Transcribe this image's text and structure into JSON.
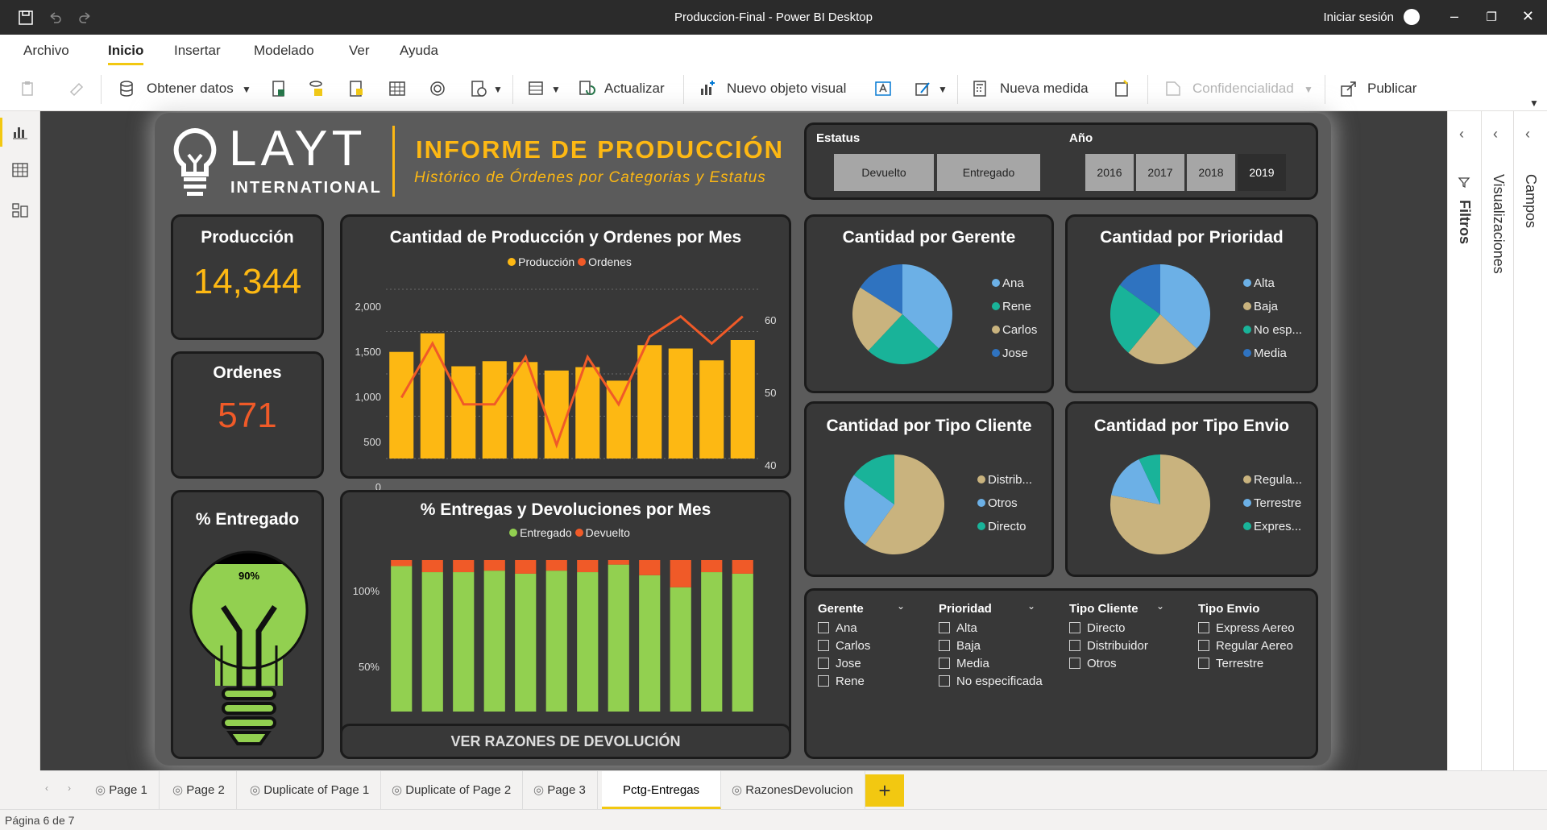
{
  "window": {
    "title": "Produccion-Final - Power BI Desktop",
    "signin": "Iniciar sesión"
  },
  "ribbon_tabs": [
    "Archivo",
    "Inicio",
    "Insertar",
    "Modelado",
    "Ver",
    "Ayuda"
  ],
  "toolbar": {
    "obtener": "Obtener datos",
    "actualizar": "Actualizar",
    "nuevo_visual": "Nuevo objeto visual",
    "nueva_medida": "Nueva medida",
    "confidencialidad": "Confidencialidad",
    "publicar": "Publicar"
  },
  "report": {
    "brand_main": "LAYT",
    "brand_sub": "INTERNATIONAL",
    "header_title": "INFORME DE PRODUCCIÓN",
    "header_subtitle": "Histórico de Órdenes por Categorias y Estatus",
    "estatus_label": "Estatus",
    "estatus_options": [
      "Devuelto",
      "Entregado"
    ],
    "anio_label": "Año",
    "anio_options": [
      "2016",
      "2017",
      "2018",
      "2019"
    ],
    "kpi_produccion": {
      "label": "Producción",
      "value": "14,344"
    },
    "kpi_ordenes": {
      "label": "Ordenes",
      "value": "571"
    },
    "kpi_entregado": {
      "label": "% Entregado",
      "value": "90%"
    },
    "button_razones": "VER RAZONES DE DEVOLUCIÓN"
  },
  "chart_data": [
    {
      "type": "bar",
      "title": "Cantidad de Producción y Ordenes por Mes",
      "series": [
        {
          "name": "Producción",
          "color": "#fdb813",
          "values": [
            1260,
            1480,
            1090,
            1150,
            1140,
            1040,
            1080,
            920,
            1340,
            1300,
            1160,
            1400
          ]
        },
        {
          "name": "Ordenes",
          "color": "#f05a28",
          "values": [
            44,
            52,
            43,
            43,
            50,
            37,
            50,
            43,
            53,
            56,
            52,
            56
          ]
        }
      ],
      "y_left_ticks": [
        "2,000",
        "1,500",
        "1,000",
        "500",
        "0"
      ],
      "y_right_ticks": [
        "60",
        "50",
        "40"
      ],
      "ylim": [
        0,
        2000
      ],
      "y2lim": [
        35,
        60
      ]
    },
    {
      "type": "bar",
      "title": "% Entregas y Devoluciones por Mes",
      "stacked": true,
      "series": [
        {
          "name": "Entregado",
          "color": "#92d050",
          "values": [
            96,
            92,
            92,
            93,
            91,
            93,
            92,
            97,
            90,
            82,
            92,
            91
          ]
        },
        {
          "name": "Devuelto",
          "color": "#f05a28",
          "values": [
            4,
            8,
            8,
            7,
            9,
            7,
            8,
            3,
            10,
            18,
            8,
            9
          ]
        }
      ],
      "y_ticks": [
        "100%",
        "50%",
        "0%"
      ],
      "ylim": [
        0,
        100
      ]
    },
    {
      "type": "pie",
      "title": "Cantidad por Gerente",
      "labels": [
        "Ana",
        "Rene",
        "Carlos",
        "Jose"
      ],
      "colors": [
        "#6cb0e6",
        "#19b399",
        "#c9b37e",
        "#2f73c0"
      ],
      "values": [
        37,
        25,
        22,
        16
      ]
    },
    {
      "type": "pie",
      "title": "Cantidad por Prioridad",
      "labels": [
        "Alta",
        "Baja",
        "No esp...",
        "Media"
      ],
      "colors": [
        "#6cb0e6",
        "#c9b37e",
        "#19b399",
        "#2f73c0"
      ],
      "values": [
        37,
        24,
        24,
        15
      ]
    },
    {
      "type": "pie",
      "title": "Cantidad por Tipo Cliente",
      "labels": [
        "Distrib...",
        "Otros",
        "Directo"
      ],
      "colors": [
        "#c9b37e",
        "#6cb0e6",
        "#19b399"
      ],
      "values": [
        60,
        25,
        15
      ]
    },
    {
      "type": "pie",
      "title": "Cantidad por Tipo Envio",
      "labels": [
        "Regula...",
        "Terrestre",
        "Expres..."
      ],
      "colors": [
        "#c9b37e",
        "#6cb0e6",
        "#19b399"
      ],
      "values": [
        78,
        15,
        7
      ]
    }
  ],
  "slicers": [
    {
      "title": "Gerente",
      "items": [
        "Ana",
        "Carlos",
        "Jose",
        "Rene"
      ]
    },
    {
      "title": "Prioridad",
      "items": [
        "Alta",
        "Baja",
        "Media",
        "No especificada"
      ]
    },
    {
      "title": "Tipo Cliente",
      "items": [
        "Directo",
        "Distribuidor",
        "Otros"
      ]
    },
    {
      "title": "Tipo Envio",
      "items": [
        "Express Aereo",
        "Regular Aereo",
        "Terrestre"
      ]
    }
  ],
  "panes": [
    "Filtros",
    "Visualizaciones",
    "Campos"
  ],
  "pages": [
    "Page 1",
    "Page 2",
    "Duplicate of Page 1",
    "Duplicate of Page 2",
    "Page 3",
    "Pctg-Entregas",
    "RazonesDevolucion"
  ],
  "active_page": "Pctg-Entregas",
  "status": "Página 6 de 7",
  "colors": {
    "accent": "#f2c811",
    "card_bg": "#383838",
    "report_bg": "#5b5b5b"
  }
}
